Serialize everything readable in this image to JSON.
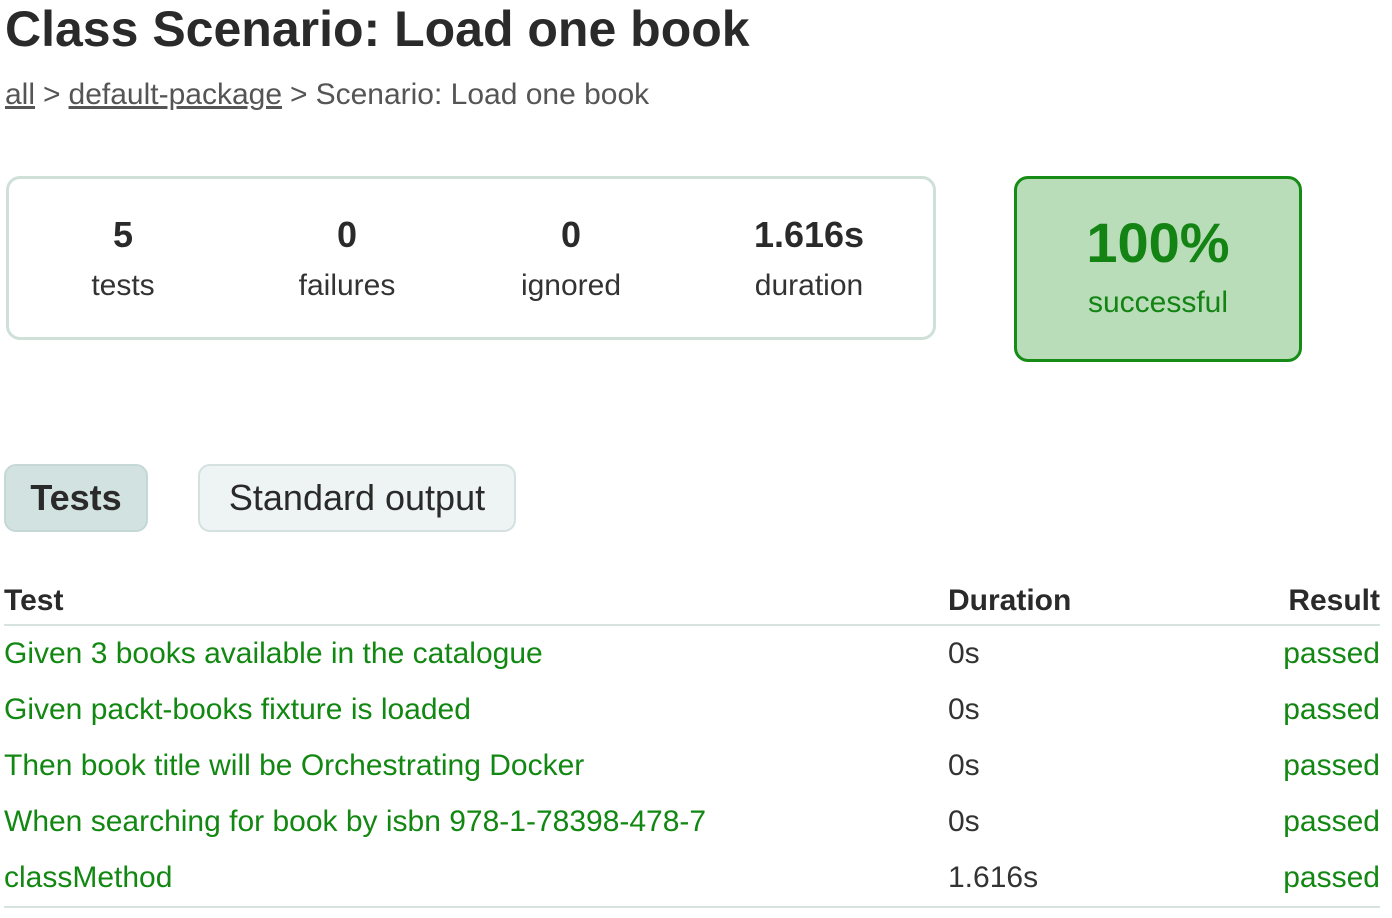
{
  "header": {
    "title": "Class Scenario: Load one book",
    "breadcrumb": {
      "all": "all",
      "package": "default-package",
      "current": "Scenario: Load one book",
      "separator": ">"
    }
  },
  "summary": {
    "tests": {
      "value": "5",
      "label": "tests"
    },
    "failures": {
      "value": "0",
      "label": "failures"
    },
    "ignored": {
      "value": "0",
      "label": "ignored"
    },
    "duration": {
      "value": "1.616s",
      "label": "duration"
    },
    "success_rate": {
      "value": "100%",
      "label": "successful"
    }
  },
  "tabs": [
    {
      "label": "Tests",
      "active": true
    },
    {
      "label": "Standard output",
      "active": false
    }
  ],
  "table": {
    "headers": {
      "test": "Test",
      "duration": "Duration",
      "result": "Result"
    },
    "rows": [
      {
        "test": "Given 3 books available in the catalogue",
        "duration": "0s",
        "result": "passed"
      },
      {
        "test": "Given packt-books fixture is loaded",
        "duration": "0s",
        "result": "passed"
      },
      {
        "test": "Then book title will be Orchestrating Docker",
        "duration": "0s",
        "result": "passed"
      },
      {
        "test": "When searching for book by isbn 978-1-78398-478-7",
        "duration": "0s",
        "result": "passed"
      },
      {
        "test": "classMethod",
        "duration": "1.616s",
        "result": "passed"
      }
    ]
  },
  "colors": {
    "success_green": "#138413",
    "success_bg": "#b9dcb9",
    "summary_border": "#cfe0d8"
  }
}
